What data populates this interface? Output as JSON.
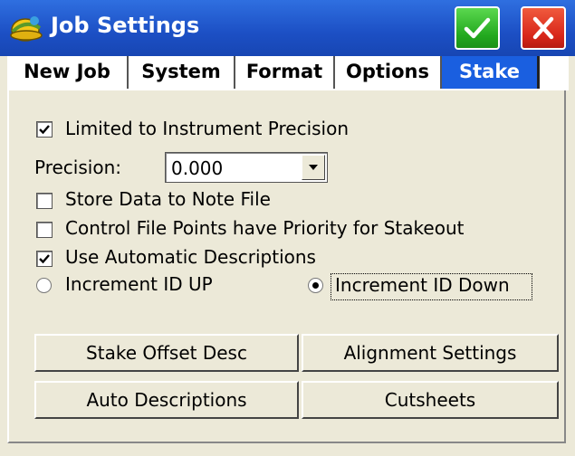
{
  "window": {
    "title": "Job Settings"
  },
  "tabs": [
    {
      "label": "New Job",
      "active": false
    },
    {
      "label": "System",
      "active": false
    },
    {
      "label": "Format",
      "active": false
    },
    {
      "label": "Options",
      "active": false
    },
    {
      "label": "Stake",
      "active": true
    }
  ],
  "stake": {
    "limited_precision": {
      "label": "Limited to Instrument Precision",
      "checked": true
    },
    "precision": {
      "label": "Precision:",
      "value": "0.000"
    },
    "store_note": {
      "label": "Store Data to Note File",
      "checked": false
    },
    "control_priority": {
      "label": "Control File Points have Priority for Stakeout",
      "checked": false
    },
    "auto_desc": {
      "label": "Use Automatic Descriptions",
      "checked": true
    },
    "increment_up": {
      "label": "Increment ID UP",
      "selected": false
    },
    "increment_down": {
      "label": "Increment ID Down",
      "selected": true
    },
    "buttons": {
      "stake_offset": "Stake Offset Desc",
      "alignment": "Alignment Settings",
      "auto_descriptions": "Auto Descriptions",
      "cutsheets": "Cutsheets"
    }
  },
  "colors": {
    "titlebar": "#1c4fc4",
    "active_tab": "#1a5fe0",
    "ok": "#22a81e",
    "close": "#d8261a"
  }
}
